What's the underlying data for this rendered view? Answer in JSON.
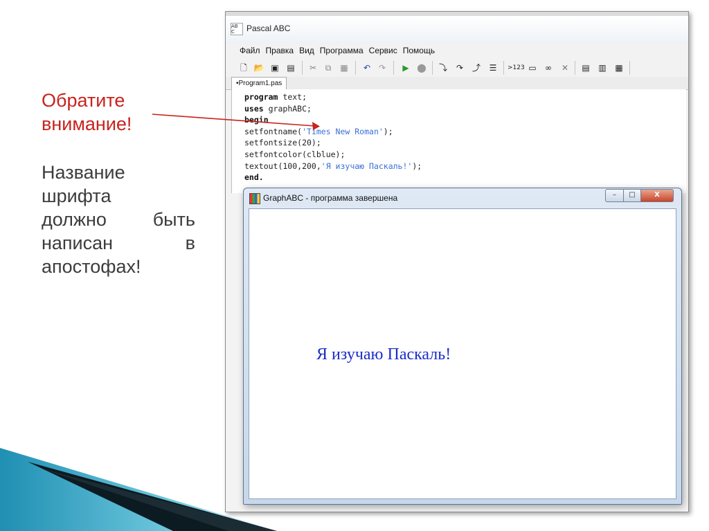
{
  "note": {
    "title_line1": "Обратите",
    "title_line2": "внимание!",
    "body": [
      [
        "Название"
      ],
      [
        "шрифта"
      ],
      [
        "должно",
        "быть"
      ],
      [
        "написан",
        "в"
      ],
      [
        "апостофах!"
      ]
    ]
  },
  "pascal": {
    "title": "Pascal ABC",
    "icon": "pascalabc-icon",
    "menu": [
      "Файл",
      "Правка",
      "Вид",
      "Программа",
      "Сервис",
      "Помощь"
    ],
    "toolbar_icons": [
      "new-file-icon",
      "open-folder-icon",
      "save-icon",
      "save-all-icon",
      "cut-icon",
      "copy-icon",
      "paste-icon",
      "undo-icon",
      "redo-icon",
      "run-icon",
      "stop-icon",
      "step-into-icon",
      "step-over-icon",
      "step-out-icon",
      "watch-icon",
      "numbers-icon",
      "window-icon",
      "glasses-icon",
      "close-x-icon",
      "format-icon",
      "list-icon",
      "grid-icon"
    ],
    "toolbar_number_label": ">123",
    "tab": "•Program1.pas",
    "code": {
      "line1_kw": "program",
      "line1_rest": " text;",
      "line2_kw": "uses",
      "line2_rest": " graphABC;",
      "line3_kw": "begin",
      "line4_pre": "setfontname(",
      "line4_str": "'Times New Roman'",
      "line4_post": ");",
      "line5": "setfontsize(20);",
      "line6": "setfontcolor(clblue);",
      "line7_pre": "textout(100,200,",
      "line7_str": "'Я изучаю Паскаль!'",
      "line7_post": ");",
      "line8_kw": "end."
    }
  },
  "graph": {
    "title": "GraphABC - программа завершена",
    "min_label": "–",
    "max_label": "□",
    "close_label": "X",
    "text": "Я изучаю Паскаль!",
    "text_color": "#1b2cc8"
  },
  "colors": {
    "accent_red": "#c8231c",
    "body_text": "#3c3c3c",
    "wedge_teal": "#2aa6c4"
  }
}
